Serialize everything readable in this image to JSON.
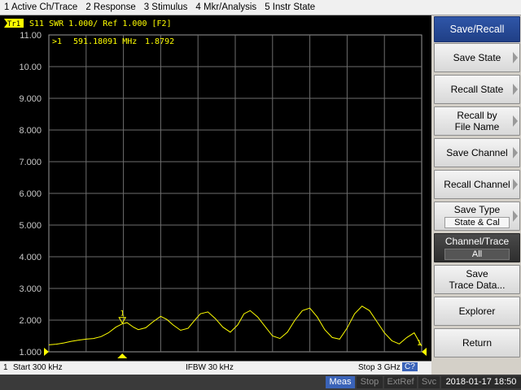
{
  "menu": {
    "items": [
      "1 Active Ch/Trace",
      "2 Response",
      "3 Stimulus",
      "4 Mkr/Analysis",
      "5 Instr State"
    ]
  },
  "trace_header": {
    "badge": "Tr1",
    "text": "S11  SWR 1.000/ Ref 1.000 [F2]"
  },
  "marker_readout": {
    "label": ">1",
    "frequency": "591.18091 MHz",
    "value": "1.8792"
  },
  "marker": {
    "number": "1",
    "end_label": "1"
  },
  "chart_data": {
    "type": "line",
    "ylim": [
      1.0,
      11.0
    ],
    "y_ticks": [
      "11.00",
      "10.00",
      "9.000",
      "8.000",
      "7.000",
      "6.000",
      "5.000",
      "4.000",
      "3.000",
      "2.000",
      "1.000"
    ],
    "x_start_ghz": 0.0003,
    "x_stop_ghz": 3.0,
    "grid": true,
    "trace_color": "#ffff00",
    "series": [
      {
        "x": [
          0.0003,
          0.06,
          0.12,
          0.18,
          0.24,
          0.3,
          0.36,
          0.42,
          0.48,
          0.54,
          0.59,
          0.63,
          0.68,
          0.72,
          0.78,
          0.84,
          0.9,
          0.95,
          1.0,
          1.06,
          1.12,
          1.17,
          1.22,
          1.28,
          1.34,
          1.4,
          1.46,
          1.52,
          1.57,
          1.62,
          1.68,
          1.74,
          1.8,
          1.86,
          1.92,
          1.98,
          2.04,
          2.1,
          2.16,
          2.22,
          2.28,
          2.34,
          2.4,
          2.46,
          2.52,
          2.58,
          2.64,
          2.7,
          2.76,
          2.82,
          2.88,
          2.94,
          3.0
        ],
        "y": [
          1.22,
          1.24,
          1.28,
          1.33,
          1.37,
          1.4,
          1.42,
          1.48,
          1.6,
          1.78,
          1.88,
          1.92,
          1.78,
          1.7,
          1.76,
          1.95,
          2.12,
          2.02,
          1.85,
          1.68,
          1.74,
          1.98,
          2.2,
          2.26,
          2.05,
          1.78,
          1.62,
          1.85,
          2.2,
          2.3,
          2.1,
          1.8,
          1.5,
          1.42,
          1.62,
          2.0,
          2.3,
          2.38,
          2.1,
          1.7,
          1.45,
          1.4,
          1.75,
          2.2,
          2.44,
          2.3,
          1.95,
          1.6,
          1.35,
          1.25,
          1.45,
          1.6,
          1.18
        ]
      }
    ]
  },
  "status_line": {
    "channel": "1",
    "start": "Start 300 kHz",
    "ifbw": "IFBW 30 kHz",
    "stop": "Stop 3 GHz",
    "cal_badge": "C?"
  },
  "bottom_bar": {
    "meas": "Meas",
    "stop": "Stop",
    "extref": "ExtRef",
    "svc": "Svc",
    "datetime": "2018-01-17 18:50"
  },
  "softkeys": {
    "title": "Save/Recall",
    "save_state": "Save State",
    "recall_state": "Recall State",
    "recall_by_file_name_1": "Recall by",
    "recall_by_file_name_2": "File Name",
    "save_channel": "Save Channel",
    "recall_channel": "Recall Channel",
    "save_type": "Save Type",
    "save_type_value": "State & Cal",
    "channel_trace": "Channel/Trace",
    "channel_trace_value": "All",
    "save_trace_data_1": "Save",
    "save_trace_data_2": "Trace Data...",
    "explorer": "Explorer",
    "return": "Return"
  },
  "colors": {
    "trace": "#ffff00",
    "softkey_title_bg": "#2f56a8",
    "meas_bg": "#3a63b8"
  }
}
